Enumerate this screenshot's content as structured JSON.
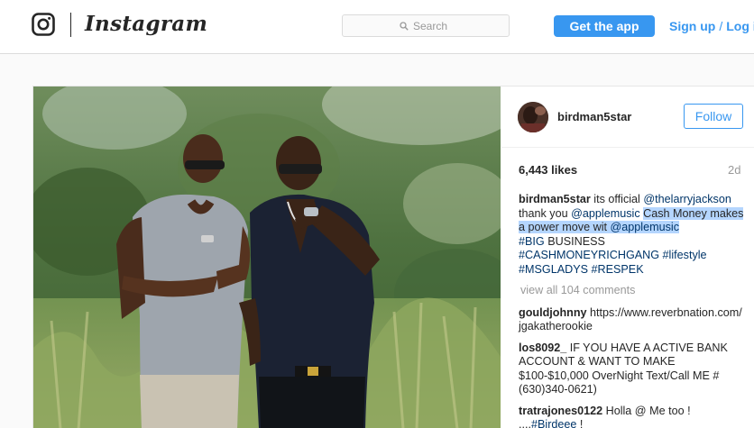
{
  "header": {
    "wordmark": "Instagram",
    "search_placeholder": "Search",
    "get_app_label": "Get the app",
    "signup_label": "Sign up",
    "login_label": "Log in"
  },
  "post": {
    "username": "birdman5star",
    "follow_label": "Follow",
    "likes": "6,443 likes",
    "age": "2d",
    "caption": {
      "author": "birdman5star",
      "t1": "its official",
      "m1": "@thelarryjackson",
      "t2": "thank you",
      "m2": "@applemusic",
      "t3": "Cash Money",
      "t4": "makes a power move wit",
      "m3": "@applemusic",
      "h1": "#BIG",
      "t5": "BUSINESS",
      "h2": "#CASHMONEYRICHGANG",
      "h3": "#lifestyle",
      "h4": "#MSGLADYS",
      "h5": "#RESPEK"
    },
    "view_all": "view all 104 comments",
    "comments": [
      {
        "author": "gouldjohnny",
        "text": "https://www.reverbnation.com/jgakatherookie"
      },
      {
        "author": "los8092_",
        "text": "IF YOU HAVE A ACTIVE BANK ACCOUNT & WANT TO MAKE $100-$10,000 OverNight Text/Call ME #(630)340-0621)"
      },
      {
        "author": "tratrajones0122",
        "text": "Holla @ Me too !",
        "text2": "....",
        "tag": "#Birdeee",
        "text3": "!"
      }
    ]
  },
  "colors": {
    "accent": "#3897f0",
    "link": "#003569",
    "selection": "#b4d5fe"
  },
  "icons": [
    "instagram-camera-icon",
    "search-icon"
  ]
}
